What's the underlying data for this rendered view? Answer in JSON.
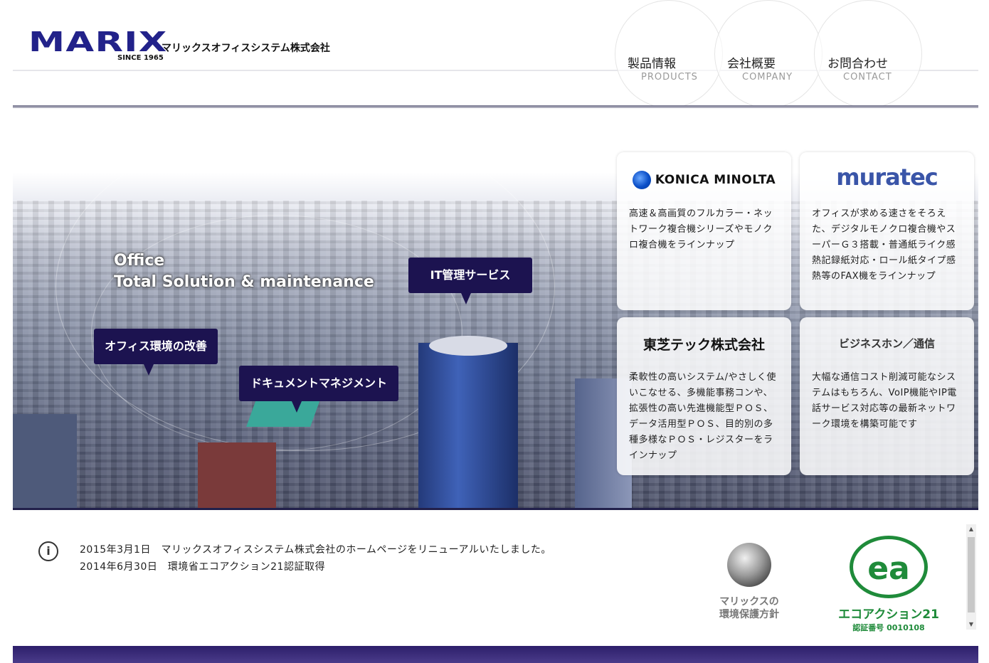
{
  "header": {
    "logo_mark": "MARIX",
    "logo_since": "SINCE 1965",
    "company_name": "マリックスオフィスシステム株式会社"
  },
  "nav": {
    "items": [
      {
        "jp": "製品情報",
        "en": "PRODUCTS"
      },
      {
        "jp": "会社概要",
        "en": "COMPANY"
      },
      {
        "jp": "お問合わせ",
        "en": "CONTACT"
      }
    ]
  },
  "hero": {
    "tagline_line1": "Office",
    "tagline_line2": "Total Solution & maintenance",
    "bubbles": [
      {
        "label": "IT管理サービス"
      },
      {
        "label": "オフィス環境の改善"
      },
      {
        "label": "ドキュメントマネジメント"
      }
    ]
  },
  "cards": [
    {
      "brand": "KONICA MINOLTA",
      "text": "高速＆高画質のフルカラー・ネットワーク複合機シリーズやモノクロ複合機をラインナップ"
    },
    {
      "brand": "muratec",
      "text": "オフィスが求める速さをそろえた、デジタルモノクロ複合機やスーパーＧ３搭載・普通紙ライク感熱記録紙対応・ロール紙タイプ感熱等のFAX機をラインナップ"
    },
    {
      "brand": "東芝テック株式会社",
      "text": "柔軟性の高いシステム/やさしく使いこなせる、多機能事務コンや、拡張性の高い先進機能型ＰＯＳ、データ活用型ＰＯＳ、目的別の多種多様なＰＯＳ・レジスターをラインナップ"
    },
    {
      "brand": "ビジネスホン／通信",
      "text": "大幅な通信コスト削減可能なシステムはもちろん、VoIP機能やIP電話サービス対応等の最新ネットワーク環境を構築可能です"
    }
  ],
  "news": {
    "icon": "info-icon",
    "items": [
      {
        "text": "2015年3月1日　マリックスオフィスシステム株式会社のホームページをリニューアルいたしました。"
      },
      {
        "text": "2014年6月30日　環境省エコアクション21認証取得"
      }
    ]
  },
  "badges": {
    "env_policy": {
      "line1": "マリックスの",
      "line2": "環境保護方針"
    },
    "eco_action": {
      "mark": "ea",
      "title": "エコアクション21",
      "cert": "認証番号  0010108"
    }
  },
  "colors": {
    "brand_navy": "#1c1350",
    "eco_green": "#1f8b3a",
    "muratec_blue": "#3a55a8"
  }
}
